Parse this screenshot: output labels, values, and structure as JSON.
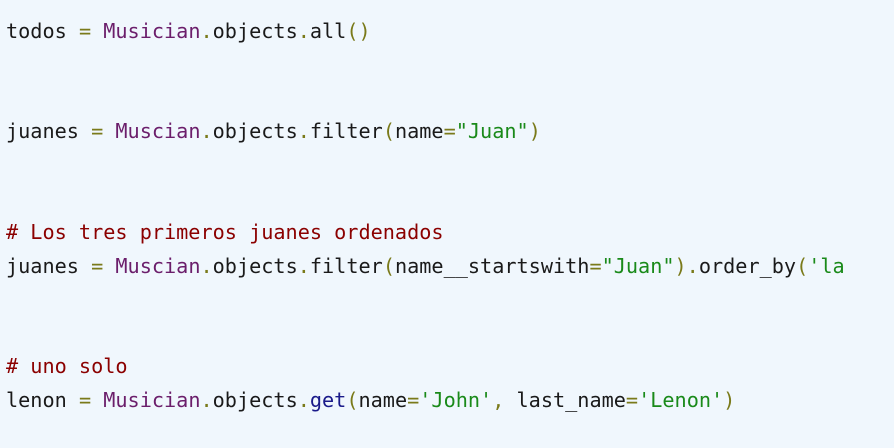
{
  "lines": [
    {
      "tokens": [
        {
          "t": "todos",
          "k": "plain"
        },
        {
          "t": " ",
          "k": "plain"
        },
        {
          "t": "=",
          "k": "op"
        },
        {
          "t": " ",
          "k": "plain"
        },
        {
          "t": "Musician",
          "k": "class"
        },
        {
          "t": ".",
          "k": "op"
        },
        {
          "t": "objects",
          "k": "plain"
        },
        {
          "t": ".",
          "k": "op"
        },
        {
          "t": "all",
          "k": "plain"
        },
        {
          "t": "()",
          "k": "op"
        }
      ]
    },
    {
      "tokens": [
        {
          "t": "juanes",
          "k": "plain"
        },
        {
          "t": " ",
          "k": "plain"
        },
        {
          "t": "=",
          "k": "op"
        },
        {
          "t": " ",
          "k": "plain"
        },
        {
          "t": "Muscian",
          "k": "class"
        },
        {
          "t": ".",
          "k": "op"
        },
        {
          "t": "objects",
          "k": "plain"
        },
        {
          "t": ".",
          "k": "op"
        },
        {
          "t": "filter",
          "k": "plain"
        },
        {
          "t": "(",
          "k": "op"
        },
        {
          "t": "name",
          "k": "plain"
        },
        {
          "t": "=",
          "k": "op"
        },
        {
          "t": "\"Juan\"",
          "k": "str"
        },
        {
          "t": ")",
          "k": "op"
        }
      ]
    },
    {
      "tokens": [
        {
          "t": "# Los tres primeros juanes ordenados",
          "k": "com"
        }
      ]
    },
    {
      "tokens": [
        {
          "t": "juanes",
          "k": "plain"
        },
        {
          "t": " ",
          "k": "plain"
        },
        {
          "t": "=",
          "k": "op"
        },
        {
          "t": " ",
          "k": "plain"
        },
        {
          "t": "Muscian",
          "k": "class"
        },
        {
          "t": ".",
          "k": "op"
        },
        {
          "t": "objects",
          "k": "plain"
        },
        {
          "t": ".",
          "k": "op"
        },
        {
          "t": "filter",
          "k": "plain"
        },
        {
          "t": "(",
          "k": "op"
        },
        {
          "t": "name__startswith",
          "k": "plain"
        },
        {
          "t": "=",
          "k": "op"
        },
        {
          "t": "\"Juan\"",
          "k": "str"
        },
        {
          "t": ").",
          "k": "op"
        },
        {
          "t": "order_by",
          "k": "plain"
        },
        {
          "t": "(",
          "k": "op"
        },
        {
          "t": "'la",
          "k": "str"
        }
      ]
    },
    {
      "tokens": [
        {
          "t": "# uno solo",
          "k": "com"
        }
      ]
    },
    {
      "tokens": [
        {
          "t": "lenon",
          "k": "plain"
        },
        {
          "t": " ",
          "k": "plain"
        },
        {
          "t": "=",
          "k": "op"
        },
        {
          "t": " ",
          "k": "plain"
        },
        {
          "t": "Musician",
          "k": "class"
        },
        {
          "t": ".",
          "k": "op"
        },
        {
          "t": "objects",
          "k": "plain"
        },
        {
          "t": ".",
          "k": "op"
        },
        {
          "t": "get",
          "k": "kw"
        },
        {
          "t": "(",
          "k": "op"
        },
        {
          "t": "name",
          "k": "plain"
        },
        {
          "t": "=",
          "k": "op"
        },
        {
          "t": "'John'",
          "k": "str"
        },
        {
          "t": ",",
          "k": "op"
        },
        {
          "t": " ",
          "k": "plain"
        },
        {
          "t": "last_name",
          "k": "plain"
        },
        {
          "t": "=",
          "k": "op"
        },
        {
          "t": "'Lenon'",
          "k": "str"
        },
        {
          "t": ")",
          "k": "op"
        }
      ]
    }
  ]
}
